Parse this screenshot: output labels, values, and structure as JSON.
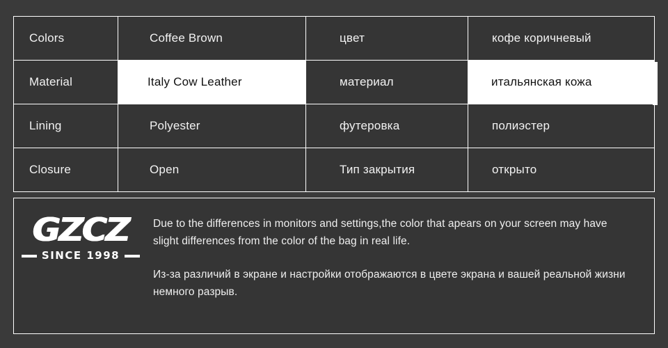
{
  "background_color": "#3a3a3a",
  "cell_color": "#353535",
  "highlight_color": "#ffffff",
  "text_color": "#f2f2f2",
  "spec_table": {
    "rows": [
      {
        "label_en": "Colors",
        "value_en": "Coffee  Brown",
        "label_ru": "цвет",
        "value_ru": "кофе  коричневый",
        "highlighted": false
      },
      {
        "label_en": "Material",
        "value_en": "Italy Cow Leather",
        "label_ru": "материал",
        "value_ru": "итальянская кожа",
        "highlighted": true
      },
      {
        "label_en": "Lining",
        "value_en": "Polyester",
        "label_ru": "футеровка",
        "value_ru": "полиэстер",
        "highlighted": false
      },
      {
        "label_en": "Closure",
        "value_en": "Open",
        "label_ru": "Тип закрытия",
        "value_ru": "открыто",
        "highlighted": false
      }
    ]
  },
  "disclaimer": {
    "logo": {
      "mark": "GZCZ",
      "since": "SINCE 1998"
    },
    "note_en": "Due to the differences in monitors and settings,the color that apears on your screen may have slight differences from the color of the bag in real life.",
    "note_ru": "Из-за различий в экране и настройки отображаются в цвете экрана и вашей реальной жизни немного разрыв."
  }
}
